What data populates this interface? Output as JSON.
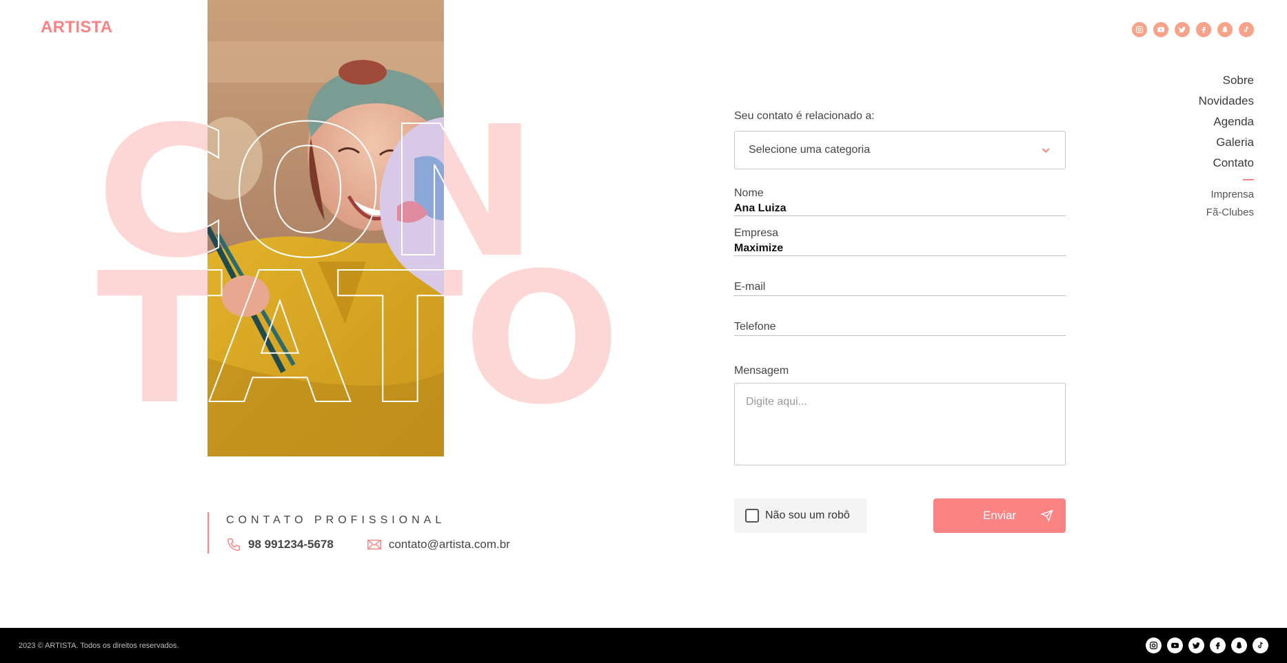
{
  "brand": {
    "logo": "ARTISTA",
    "accent_color": "#fb8383",
    "soft_pink": "#fdd6d6"
  },
  "social_icons": [
    "instagram-icon",
    "youtube-icon",
    "twitter-icon",
    "facebook-icon",
    "snapchat-icon",
    "tiktok-icon"
  ],
  "nav": {
    "items": [
      "Sobre",
      "Novidades",
      "Agenda",
      "Galeria",
      "Contato"
    ],
    "active": "Contato",
    "sub_items": [
      "Imprensa",
      "Fã-Clubes"
    ]
  },
  "hero": {
    "word_line1": "CON",
    "word_line2": "TATO"
  },
  "form": {
    "category_label": "Seu contato é relacionado a:",
    "category_value": "Selecione uma categoria",
    "fields": [
      {
        "label": "Nome",
        "value": "Ana Luiza"
      },
      {
        "label": "Empresa",
        "value": "Maximize"
      },
      {
        "label": "E-mail",
        "value": ""
      },
      {
        "label": "Telefone",
        "value": ""
      }
    ],
    "message_label": "Mensagem",
    "message_placeholder": "Digite aqui...",
    "captcha_label": "Não sou um robô",
    "submit_label": "Enviar"
  },
  "professional_contact": {
    "title": "CONTATO PROFISSIONAL",
    "phone": "98 991234-5678",
    "email": "contato@artista.com.br"
  },
  "footer": {
    "copyright": "2023 © ARTISTA. Todos os direitos reservados."
  }
}
